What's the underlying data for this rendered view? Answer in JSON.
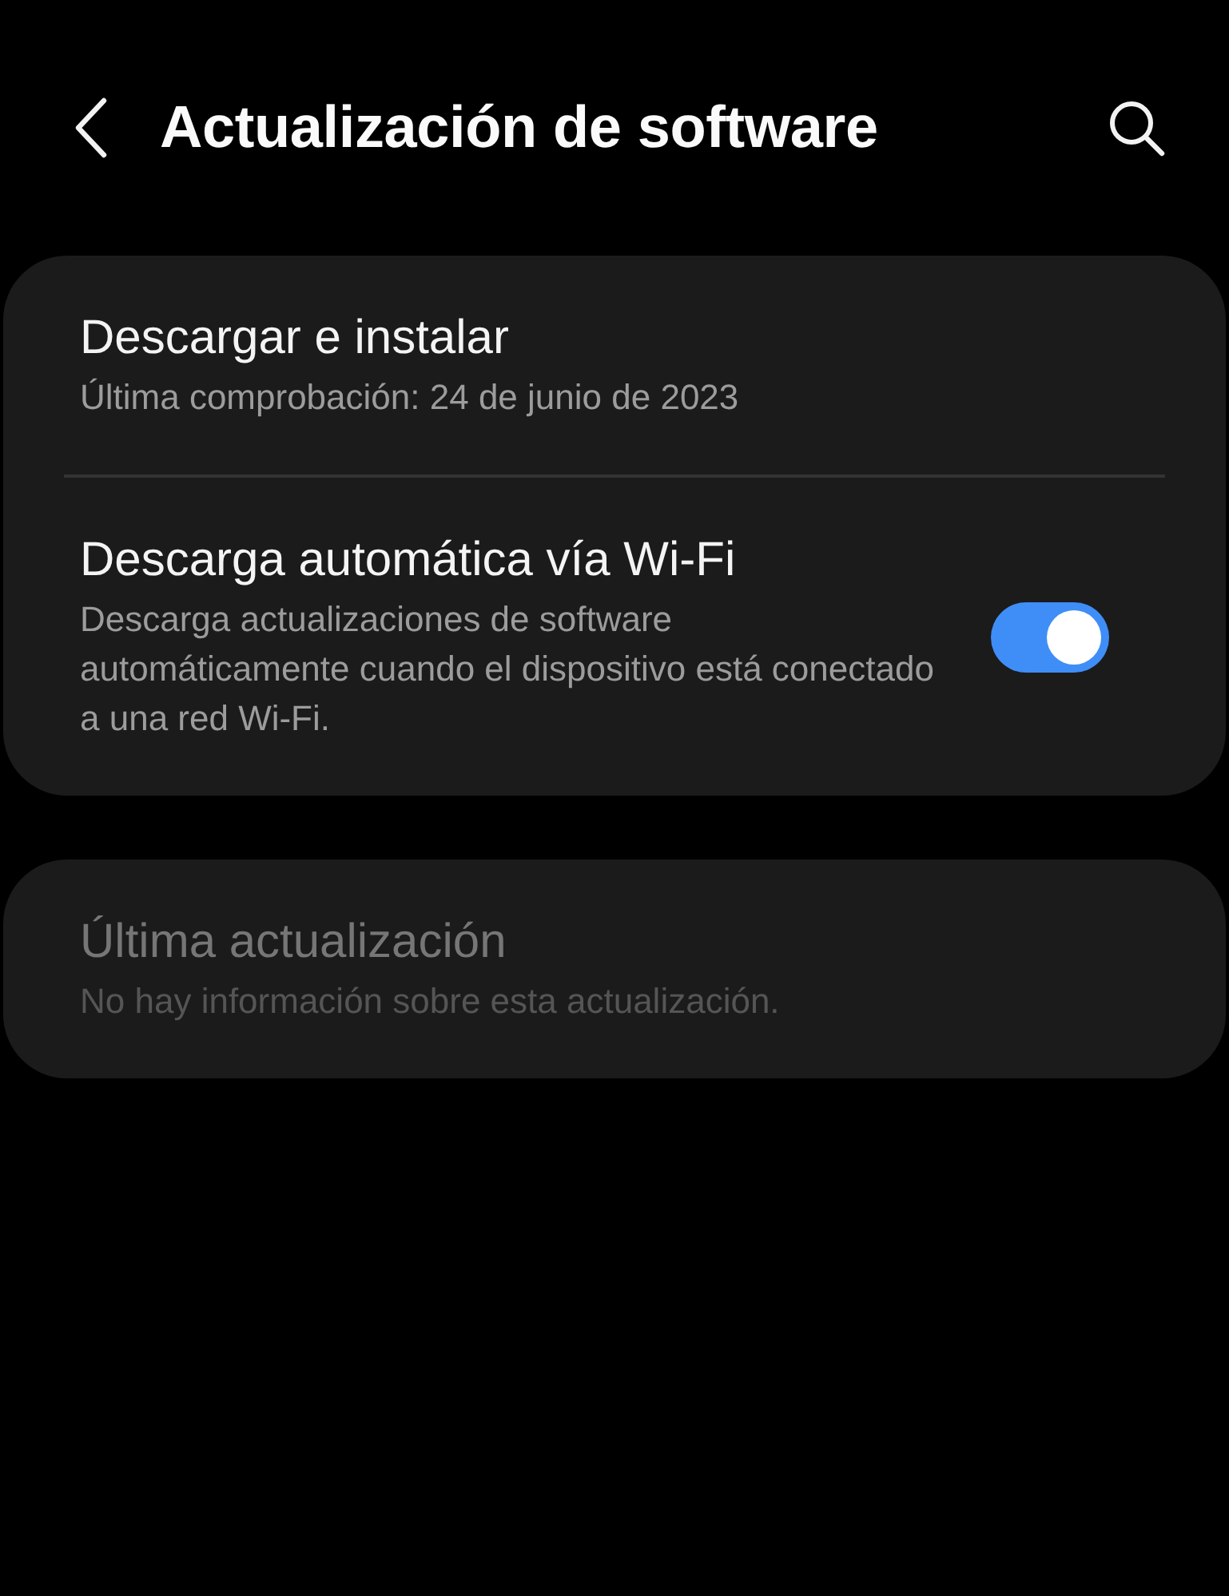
{
  "header": {
    "title": "Actualización de software"
  },
  "cards": [
    {
      "items": [
        {
          "kind": "plain",
          "title": "Descargar e instalar",
          "subtitle": "Última comprobación: 24 de junio de 2023",
          "disabled": false
        },
        {
          "kind": "switch",
          "title": "Descarga automática vía Wi-Fi",
          "subtitle": "Descarga actualizaciones de software automáticamente cuando el dispositivo está conectado a una red Wi-Fi.",
          "disabled": false,
          "on": true
        }
      ]
    },
    {
      "items": [
        {
          "kind": "plain",
          "title": "Última actualización",
          "subtitle": "No hay información sobre esta actualización.",
          "disabled": true
        }
      ]
    }
  ]
}
